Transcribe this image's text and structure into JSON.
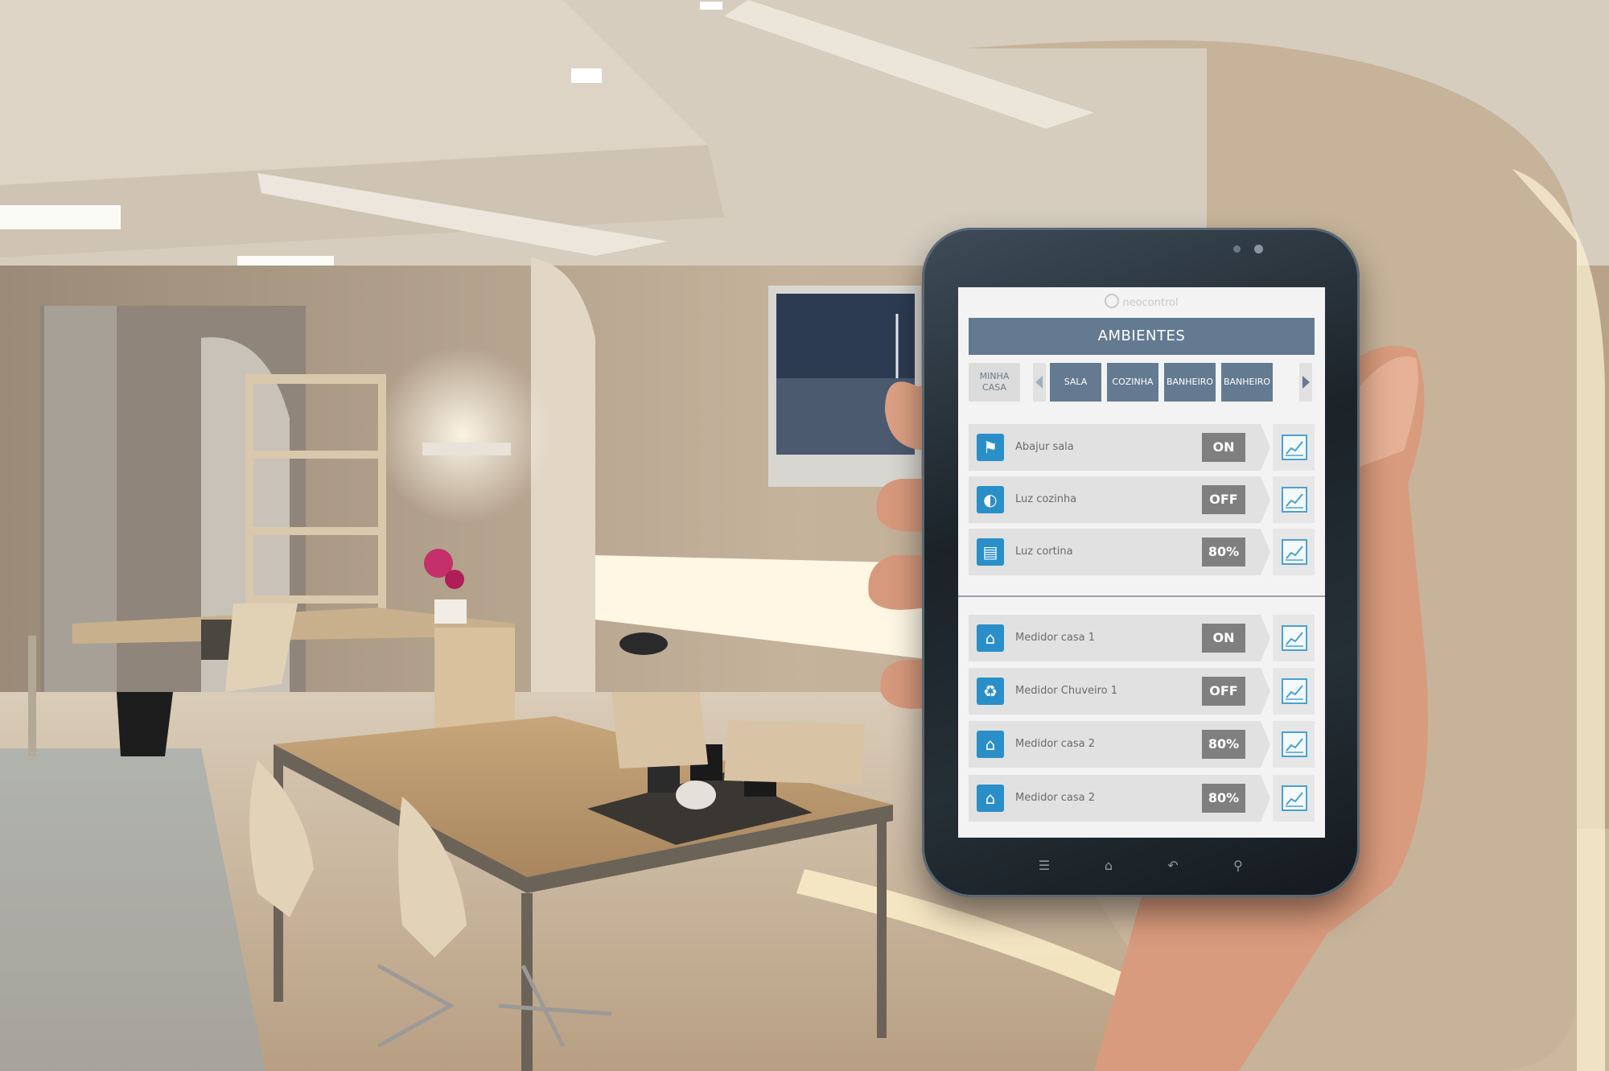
{
  "app": {
    "brand": "neocontrol",
    "header_title": "AMBIENTES"
  },
  "tabs": {
    "home_label": "MINHA CASA",
    "items": [
      "SALA",
      "COZINHA",
      "BANHEIRO",
      "BANHEIRO"
    ]
  },
  "devices_group1": [
    {
      "name": "Abajur sala",
      "status": "ON",
      "icon": "lamp-icon"
    },
    {
      "name": "Luz cozinha",
      "status": "OFF",
      "icon": "ceiling-light-icon"
    },
    {
      "name": "Luz cortina",
      "status": "80%",
      "icon": "curtain-icon"
    }
  ],
  "devices_group2": [
    {
      "name": "Medidor casa 1",
      "status": "ON",
      "icon": "house-icon"
    },
    {
      "name": "Medidor Chuveiro 1",
      "status": "OFF",
      "icon": "bathtub-icon"
    },
    {
      "name": "Medidor casa 2",
      "status": "80%",
      "icon": "house-icon"
    },
    {
      "name": "Medidor casa 2",
      "status": "80%",
      "icon": "house-icon"
    }
  ],
  "colors": {
    "header_blue": "#637a91",
    "icon_blue": "#2a8fc8",
    "status_gray": "#7f7f7f",
    "row_gray": "#e1e1e1"
  },
  "phone_nav": [
    "menu-icon",
    "home-icon",
    "back-icon",
    "search-icon"
  ]
}
